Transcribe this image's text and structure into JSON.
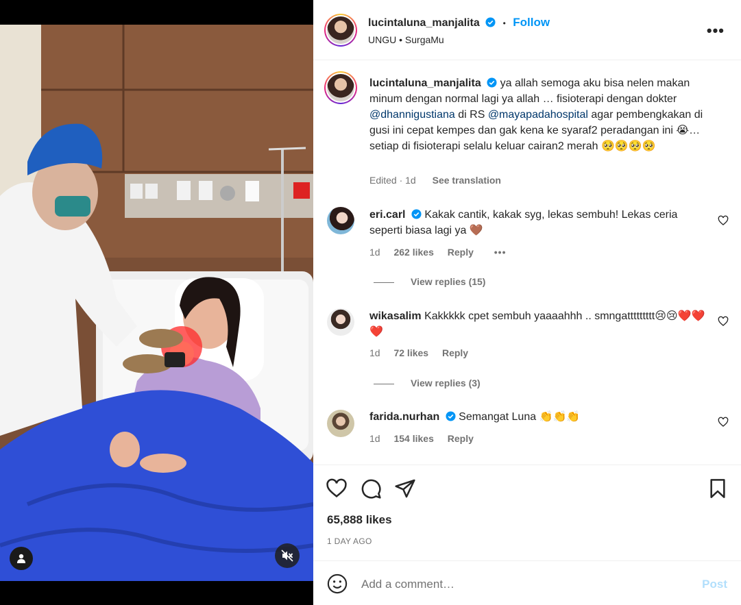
{
  "post": {
    "username": "lucintaluna_manjalita",
    "follow_label": "Follow",
    "separator": "•",
    "audio": "UNGU • SurgaMu",
    "more_label": "•••"
  },
  "caption": {
    "username": "lucintaluna_manjalita",
    "text_1": "ya allah semoga aku bisa nelen makan minum dengan normal lagi ya allah … fisioterapi dengan dokter",
    "mention_1": "@dhannigustiana",
    "text_2": "di RS",
    "mention_2": "@mayapadahospital",
    "text_3": "agar pembengkakan di gusi ini cepat kempes dan gak kena ke syaraf2 peradangan ini 😭… setiap di fisioterapi selalu keluar cairan2 merah 🥺🥺🥺🥺",
    "edited": "Edited · 1d",
    "see_translation": "See translation"
  },
  "comments": [
    {
      "username": "eri.carl",
      "verified": true,
      "text": "Kakak cantik, kakak syg, lekas sembuh! Lekas ceria seperti biasa lagi ya 🤎",
      "time": "1d",
      "likes": "262 likes",
      "reply": "Reply",
      "more": "•••",
      "view_replies": "View replies (15)"
    },
    {
      "username": "wikasalim",
      "verified": false,
      "text": "Kakkkkk cpet sembuh yaaaahhh .. smngattttttttt😢😢❤️❤️❤️",
      "time": "1d",
      "likes": "72 likes",
      "reply": "Reply",
      "view_replies": "View replies (3)"
    },
    {
      "username": "farida.nurhan",
      "verified": true,
      "text": "Semangat Luna 👏👏👏",
      "time": "1d",
      "likes": "154 likes",
      "reply": "Reply"
    }
  ],
  "actions": {
    "like_icon": "heart-icon",
    "comment_icon": "comment-icon",
    "share_icon": "send-icon",
    "save_icon": "bookmark-icon",
    "likes": "65,888 likes",
    "time_ago": "1 DAY AGO"
  },
  "composer": {
    "placeholder": "Add a comment…",
    "post_label": "Post"
  },
  "colors": {
    "accent": "#0095f6",
    "post_disabled": "#b2dffc",
    "verified": "#0095f6",
    "muted": "#737373"
  }
}
